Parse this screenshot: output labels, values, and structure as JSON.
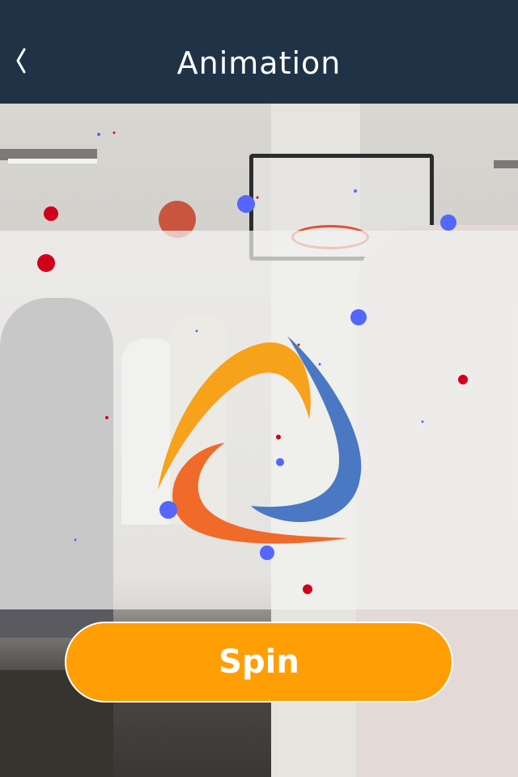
{
  "navbar": {
    "title": "Animation",
    "background": "#1f3246"
  },
  "icons": {
    "back": "chevron-left-icon",
    "logo": "tricolor-swirl-logo"
  },
  "actions": {
    "spin_label": "Spin",
    "spin_color": "#ff9e05"
  },
  "colors": {
    "logo_orange": "#f7a21b",
    "logo_red_orange": "#f06a2a",
    "logo_blue": "#4a78c2",
    "particle_red": "#d0021b",
    "particle_blue": "#5566ff"
  }
}
